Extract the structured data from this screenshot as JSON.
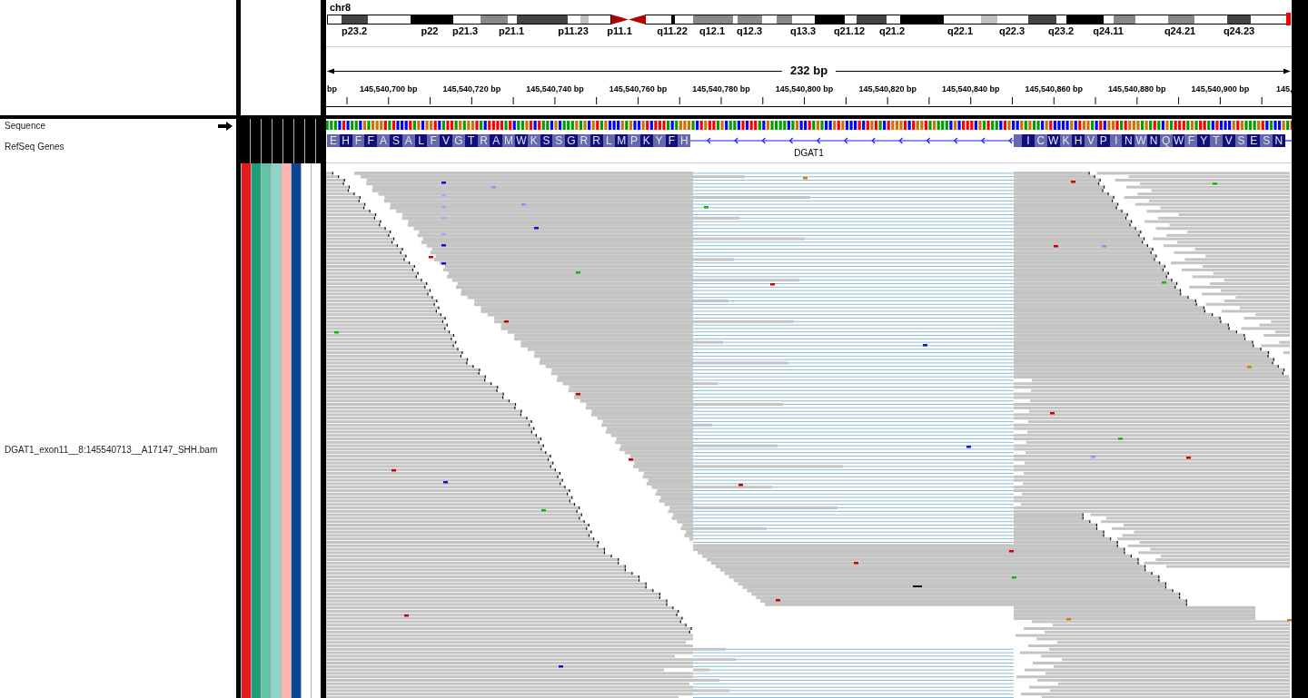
{
  "header": {
    "chromosome": "chr8",
    "cytobands": [
      "p23.2",
      "p22",
      "p21.3",
      "p21.1",
      "p11.23",
      "p11.1",
      "q11.22",
      "q12.1",
      "q12.3",
      "q13.3",
      "q21.12",
      "q21.2",
      "q22.1",
      "q22.3",
      "q23.2",
      "q24.11",
      "q24.21",
      "q24.23"
    ],
    "span": "232 bp",
    "ruler_labels": [
      "bp",
      "145,540,700 bp",
      "145,540,720 bp",
      "145,540,740 bp",
      "145,540,760 bp",
      "145,540,780 bp",
      "145,540,800 bp",
      "145,540,820 bp",
      "145,540,840 bp",
      "145,540,860 bp",
      "145,540,880 bp",
      "145,540,900 bp",
      "145,"
    ]
  },
  "tracks": [
    {
      "kind": "sequence",
      "name": "Sequence",
      "reverse_strand": false
    },
    {
      "kind": "gene",
      "name": "RefSeq Genes",
      "gene": "DGAT1",
      "reverse_strand": true,
      "exons": [
        {
          "partial_codon_start": false,
          "amino_acids": [
            "E",
            "H",
            "F",
            "F",
            "A",
            "S",
            "A",
            "L",
            "F",
            "V",
            "G",
            "T",
            "R",
            "A",
            "M",
            "W",
            "K",
            "S",
            "S",
            "G",
            "R",
            "R",
            "L",
            "M",
            "P",
            "K",
            "Y",
            "F",
            "H"
          ]
        },
        {
          "partial_codon_start": true,
          "amino_acids": [
            "I",
            "C",
            "W",
            "K",
            "H",
            "V",
            "P",
            "I",
            "N",
            "W",
            "N",
            "Q",
            "W",
            "F",
            "Y",
            "T",
            "V",
            "S",
            "E",
            "S",
            "N"
          ]
        }
      ]
    },
    {
      "kind": "alignment",
      "name": "DGAT1_exon11__8:145540713__A17147_SHH.bam",
      "attributes": [
        {
          "color": "#e41a1c"
        },
        {
          "color": "#1b9e77"
        },
        {
          "color": "#66c2a5"
        },
        {
          "color": "#8dd3c7"
        },
        {
          "color": "#fbb4ae"
        },
        {
          "color": "#0b4595"
        },
        {
          "color": "#ffffff"
        },
        {
          "color": "#ffffff"
        }
      ]
    }
  ]
}
